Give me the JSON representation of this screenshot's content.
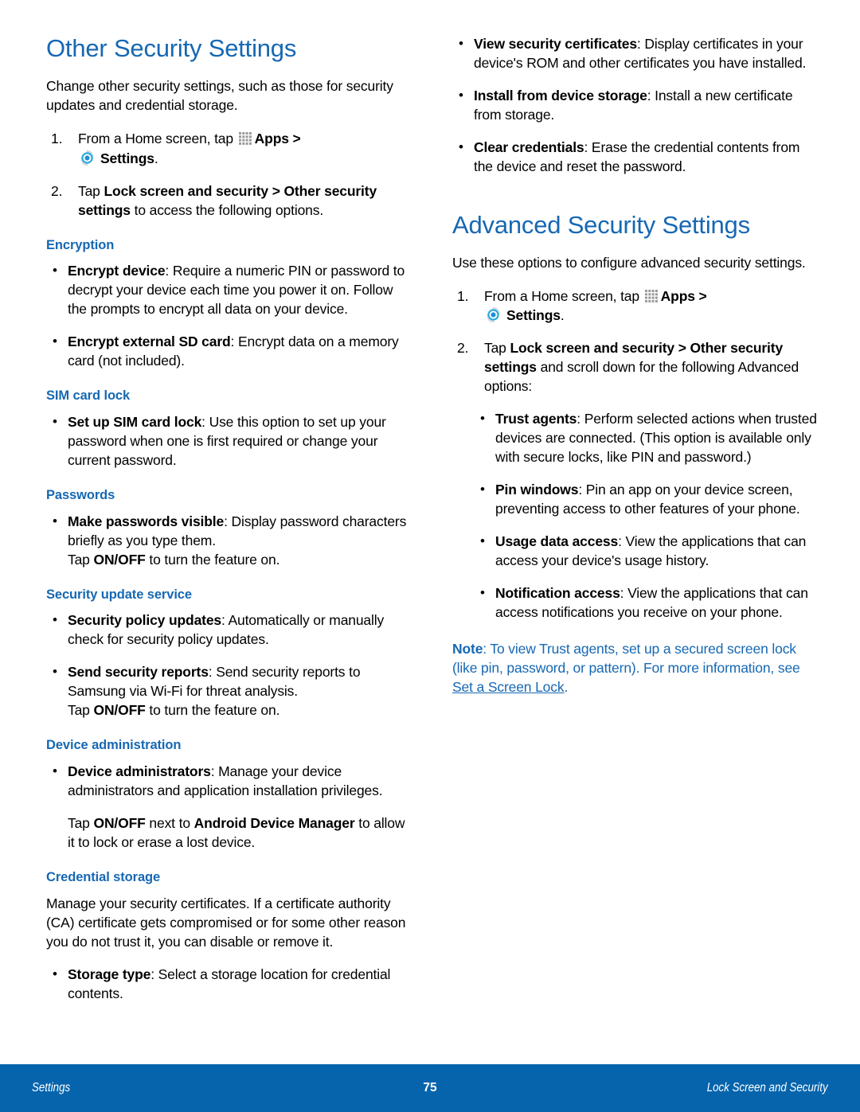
{
  "colors": {
    "heading_blue": "#1668b3",
    "footer_blue": "#0664ad",
    "gear_blue": "#29abe2",
    "apps_gray": "#9a9a9a"
  },
  "left_column": {
    "title": "Other Security Settings",
    "intro": "Change other security settings, such as those for security updates and credential storage.",
    "steps": [
      {
        "num": "1.",
        "text_before_apps": "From a Home screen, tap ",
        "apps_label": "Apps",
        "after_apps": " >",
        "settings_label": "Settings",
        "after_settings": "."
      },
      {
        "num": "2.",
        "lead": "Tap ",
        "bold1": "Lock screen and security > Other security settings",
        "tail": " to access the following options."
      }
    ],
    "sections": [
      {
        "heading": "Encryption",
        "items": [
          {
            "term": "Encrypt device",
            "desc": ": Require a numeric PIN or password to decrypt your device each time you power it on. Follow the prompts to encrypt all data on your device."
          },
          {
            "term": "Encrypt external SD card",
            "desc": ": Encrypt data on a memory card (not included)."
          }
        ]
      },
      {
        "heading": "SIM card lock",
        "items": [
          {
            "term": "Set up SIM card lock",
            "desc": ": Use this option to set up your password when one is first required or change your current password."
          }
        ]
      },
      {
        "heading": "Passwords",
        "items": [
          {
            "term": "Make passwords visible",
            "desc": ": Display password characters briefly as you type them."
          }
        ],
        "extra_tap": {
          "pre": "Tap ",
          "bold": "ON/OFF",
          "post": " to turn the feature on."
        }
      },
      {
        "heading": "Security update service",
        "items": [
          {
            "term": "Security policy updates",
            "desc": ": Automatically or manually check for security policy updates."
          },
          {
            "term": "Send security reports",
            "desc": ": Send security reports to Samsung via Wi-Fi for threat analysis."
          }
        ],
        "extra_tap": {
          "pre": "Tap ",
          "bold": "ON/OFF",
          "post": " to turn the feature on."
        }
      },
      {
        "heading": "Device administration",
        "items": [
          {
            "term": "Device administrators",
            "desc": ": Manage your device administrators and application installation privileges."
          }
        ]
      },
      {
        "heading": "Credential storage",
        "items": []
      }
    ],
    "device_admin_tap": {
      "pre": "Tap ",
      "bold1": "ON/OFF",
      "mid": " next to ",
      "bold2": "Android Device Manager",
      "post": " to allow it to lock or erase a lost device."
    },
    "credential_storage_para": "Manage your security certificates. If a certificate authority (CA) certificate gets compromised or for some other reason you do not trust it, you can disable or remove it.",
    "credential_storage_bullet": {
      "term": "Storage type",
      "desc": ": Select a storage location for credential contents."
    }
  },
  "right_column": {
    "top_bullets": [
      {
        "term": "View security certificates",
        "desc": ": Display certificates in your device's ROM and other certificates you have installed."
      },
      {
        "term": "Install from device storage",
        "desc": ": Install a new certificate from storage."
      },
      {
        "term": "Clear credentials",
        "desc": ": Erase the credential contents from the device and reset the password."
      }
    ],
    "title": "Advanced Security Settings",
    "intro": "Use these options to configure advanced security settings.",
    "steps": [
      {
        "num": "1.",
        "text_before_apps": "From a Home screen, tap ",
        "apps_label": "Apps",
        "after_apps": " >",
        "settings_label": "Settings",
        "after_settings": "."
      },
      {
        "num": "2.",
        "lead": "Tap ",
        "bold1": "Lock screen and security > Other security settings",
        "tail": " and scroll down for the following Advanced options:"
      }
    ],
    "advanced_bullets": [
      {
        "term": "Trust agents",
        "desc": ": Perform selected actions when trusted devices are connected. (This option is available only with secure locks, like PIN and password.)"
      },
      {
        "term": "Pin windows",
        "desc": ": Pin an app on your device screen, preventing access to other features of your phone."
      },
      {
        "term": "Usage data access",
        "desc": ": View the applications that can access your device's usage history."
      },
      {
        "term": "Notification access",
        "desc": ": View the applications that can access notifications you receive on your phone."
      }
    ],
    "note": {
      "label": "Note",
      "text_before_link": ": To view Trust agents, set up a secured screen lock (like pin, password, or pattern). For more information, see ",
      "link": "Set a Screen Lock",
      "text_after_link": "."
    }
  },
  "footer": {
    "left": "Settings",
    "page_number": "75",
    "right": "Lock Screen and Security"
  }
}
